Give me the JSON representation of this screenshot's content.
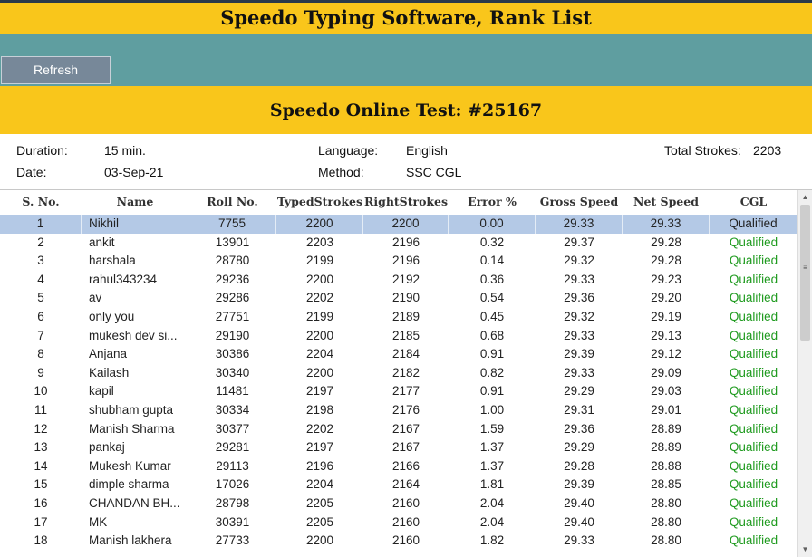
{
  "header": {
    "title": "Speedo Typing Software, Rank List"
  },
  "toolbar": {
    "refresh_label": "Refresh"
  },
  "test": {
    "title": "Speedo Online Test: #25167"
  },
  "info": {
    "duration_label": "Duration:",
    "duration_value": "15 min.",
    "date_label": "Date:",
    "date_value": "03-Sep-21",
    "language_label": "Language:",
    "language_value": "English",
    "method_label": "Method:",
    "method_value": "SSC CGL",
    "total_strokes_label": "Total Strokes:",
    "total_strokes_value": "2203"
  },
  "table": {
    "columns": [
      "S. No.",
      "Name",
      "Roll No.",
      "TypedStrokes",
      "RightStrokes",
      "Error %",
      "Gross Speed",
      "Net Speed",
      "CGL"
    ],
    "rows": [
      [
        "1",
        "Nikhil",
        "7755",
        "2200",
        "2200",
        "0.00",
        "29.33",
        "29.33",
        "Qualified"
      ],
      [
        "2",
        "ankit",
        "13901",
        "2203",
        "2196",
        "0.32",
        "29.37",
        "29.28",
        "Qualified"
      ],
      [
        "3",
        "harshala",
        "28780",
        "2199",
        "2196",
        "0.14",
        "29.32",
        "29.28",
        "Qualified"
      ],
      [
        "4",
        "rahul343234",
        "29236",
        "2200",
        "2192",
        "0.36",
        "29.33",
        "29.23",
        "Qualified"
      ],
      [
        "5",
        "av",
        "29286",
        "2202",
        "2190",
        "0.54",
        "29.36",
        "29.20",
        "Qualified"
      ],
      [
        "6",
        "only you",
        "27751",
        "2199",
        "2189",
        "0.45",
        "29.32",
        "29.19",
        "Qualified"
      ],
      [
        "7",
        "mukesh dev si...",
        "29190",
        "2200",
        "2185",
        "0.68",
        "29.33",
        "29.13",
        "Qualified"
      ],
      [
        "8",
        "Anjana",
        "30386",
        "2204",
        "2184",
        "0.91",
        "29.39",
        "29.12",
        "Qualified"
      ],
      [
        "9",
        "Kailash",
        "30340",
        "2200",
        "2182",
        "0.82",
        "29.33",
        "29.09",
        "Qualified"
      ],
      [
        "10",
        "kapil",
        "11481",
        "2197",
        "2177",
        "0.91",
        "29.29",
        "29.03",
        "Qualified"
      ],
      [
        "11",
        "shubham gupta",
        "30334",
        "2198",
        "2176",
        "1.00",
        "29.31",
        "29.01",
        "Qualified"
      ],
      [
        "12",
        "Manish Sharma",
        "30377",
        "2202",
        "2167",
        "1.59",
        "29.36",
        "28.89",
        "Qualified"
      ],
      [
        "13",
        "pankaj",
        "29281",
        "2197",
        "2167",
        "1.37",
        "29.29",
        "28.89",
        "Qualified"
      ],
      [
        "14",
        "Mukesh Kumar",
        "29113",
        "2196",
        "2166",
        "1.37",
        "29.28",
        "28.88",
        "Qualified"
      ],
      [
        "15",
        "dimple sharma",
        "17026",
        "2204",
        "2164",
        "1.81",
        "29.39",
        "28.85",
        "Qualified"
      ],
      [
        "16",
        "CHANDAN BH...",
        "28798",
        "2205",
        "2160",
        "2.04",
        "29.40",
        "28.80",
        "Qualified"
      ],
      [
        "17",
        "MK",
        "30391",
        "2205",
        "2160",
        "2.04",
        "29.40",
        "28.80",
        "Qualified"
      ],
      [
        "18",
        "Manish lakhera",
        "27733",
        "2200",
        "2160",
        "1.82",
        "29.33",
        "28.80",
        "Qualified"
      ]
    ]
  },
  "colors": {
    "header_yellow": "#f9c61b",
    "toolbar_teal": "#5f9ea0",
    "button_gray": "#778899",
    "selected_row": "#b4c9e6",
    "qualified_green": "#1e9a1e"
  },
  "icons": {
    "scroll_up": "triangle-up-icon",
    "scroll_down": "triangle-down-icon"
  }
}
